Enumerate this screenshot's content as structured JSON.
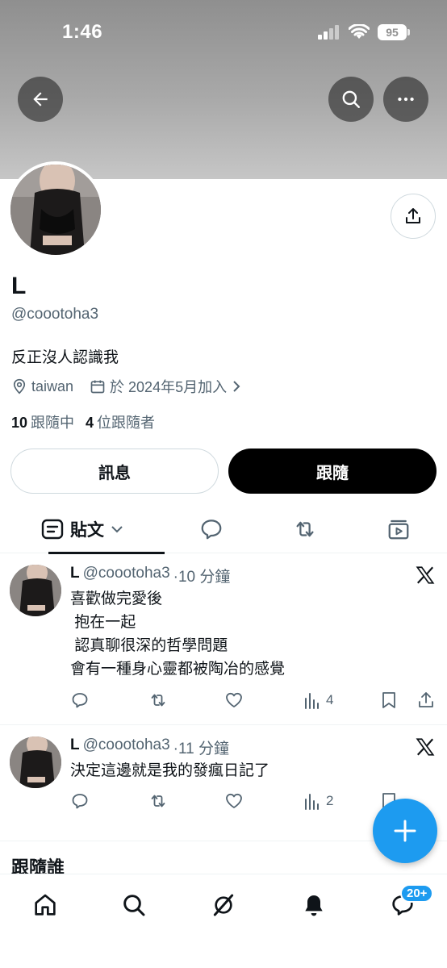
{
  "status_bar": {
    "time": "1:46",
    "battery": "95"
  },
  "profile": {
    "name": "L",
    "handle": "@cooo toha3",
    "bio": "反正沒人認識我",
    "location": "taiwan",
    "joined": "於 2024年5月加入",
    "following_count": "10",
    "following_label": "跟隨中",
    "followers_count": "4",
    "followers_label": "位跟隨者"
  },
  "buttons": {
    "message": "訊息",
    "follow": "跟隨"
  },
  "tabs": {
    "posts": "貼文"
  },
  "posts": [
    {
      "name": "L",
      "handle": "@coootoha3",
      "time": "·10 分鐘",
      "lines": [
        "喜歡做完愛後",
        " 抱在一起",
        " 認真聊很深的哲學問題",
        "會有一種身心靈都被陶冶的感覺"
      ],
      "views": "4"
    },
    {
      "name": "L",
      "handle": "@coootoha3",
      "time": "·11 分鐘",
      "lines": [
        "決定這邊就是我的發瘋日記了"
      ],
      "views": "2"
    }
  ],
  "who_to_follow": "跟隨誰",
  "nav": {
    "messages_badge": "20+"
  },
  "colors": {
    "accent": "#1d9bf0",
    "text": "#0f1419",
    "secondary": "#536471"
  }
}
